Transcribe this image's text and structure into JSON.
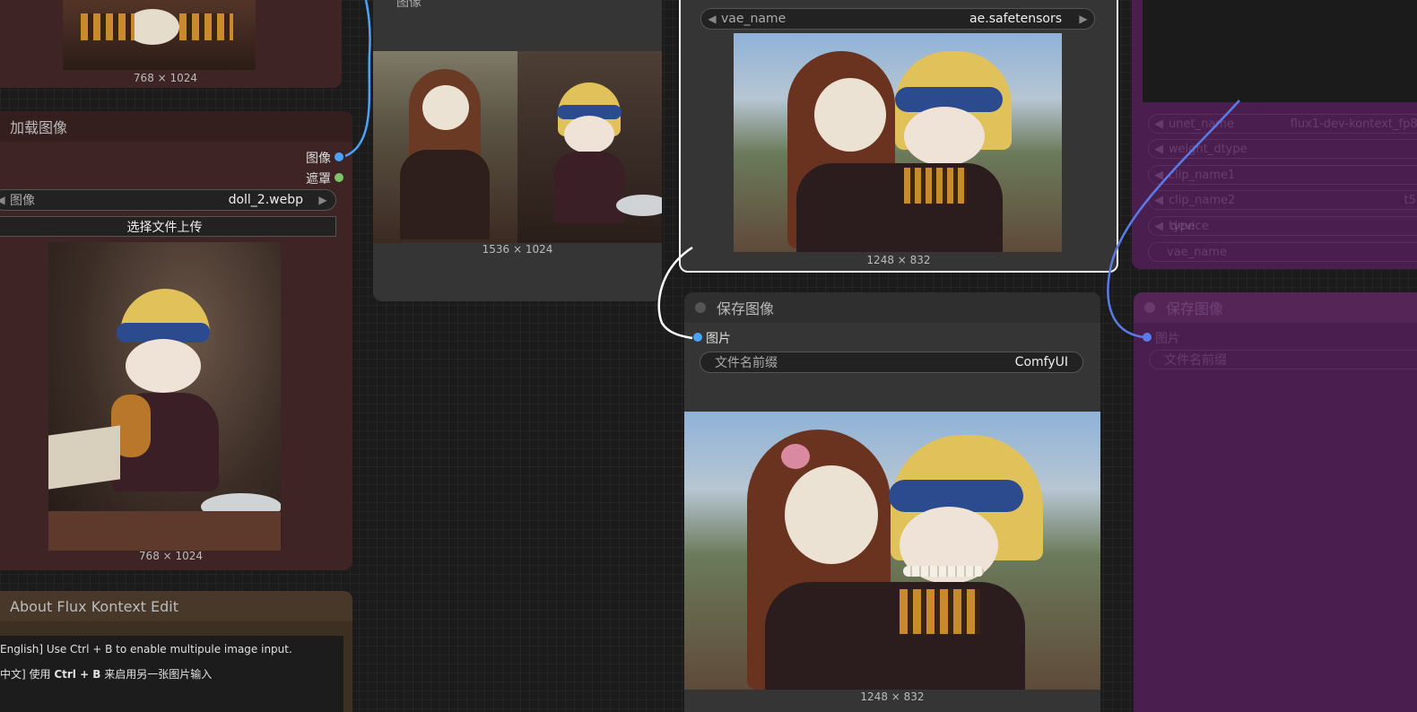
{
  "top_left_node": {
    "image_size": "768 × 1024"
  },
  "load_image_node": {
    "title": "加载图像",
    "outputs": [
      "图像",
      "遮罩"
    ],
    "image_widget": {
      "label": "图像",
      "value": "doll_2.webp"
    },
    "upload_button": "选择文件上传",
    "image_size": "768 × 1024"
  },
  "about_node": {
    "title": "About Flux Kontext Edit",
    "line1": "English] Use Ctrl + B to enable multipule image input.",
    "line2_prefix": "中文] 使用 ",
    "line2_bold": "Ctrl + B",
    "line2_suffix": " 来启用另一张图片输入"
  },
  "stitch_node": {
    "partial_label": "图像",
    "image_size": "1536 × 1024"
  },
  "decode_node": {
    "vae_label": "vae_name",
    "vae_value": "ae.safetensors",
    "image_size": "1248 × 832"
  },
  "save_node": {
    "title": "保存图像",
    "input_label": "图片",
    "prefix_label": "文件名前缀",
    "prefix_value": "ComfyUI",
    "image_size": "1248 × 832"
  },
  "bypassed_loader": {
    "rows": [
      {
        "label": "unet_name",
        "value": "flux1-dev-kontext_fp8_sca"
      },
      {
        "label": "weight_dtype",
        "value": ""
      },
      {
        "label": "clip_name1",
        "value": "cl"
      },
      {
        "label": "clip_name2",
        "value": "t5xxl_f"
      },
      {
        "label": "type",
        "value": ""
      },
      {
        "label": "device",
        "value": ""
      },
      {
        "label": "vae_name",
        "value": ""
      }
    ]
  },
  "bypassed_save": {
    "title": "保存图像",
    "input_label": "图片",
    "prefix_label": "文件名前缀"
  },
  "colors": {
    "load_node_bg": "#3e2424",
    "dark_node_bg": "#353535",
    "bypass_purple": "#4a1f4f",
    "link_blue": "#4aa3ff",
    "link_white": "#ffffff",
    "mask_green": "#7ec46a"
  }
}
